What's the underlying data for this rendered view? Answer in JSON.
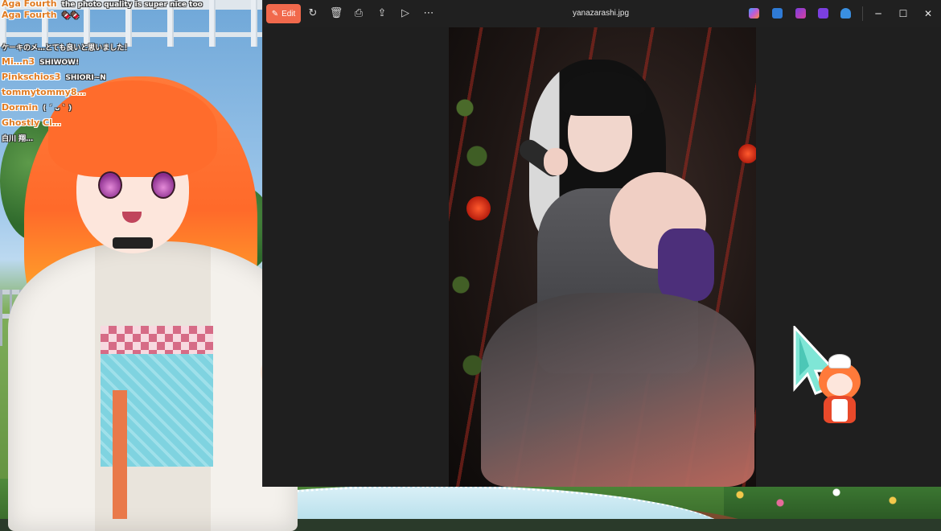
{
  "chat": {
    "lines": [
      {
        "user": "Aga Fourth",
        "message": "the photo quality is super nice too"
      },
      {
        "user": "",
        "message": "ケーキのメ…とても良いと思いました！"
      },
      {
        "user": "Mi…n3",
        "message": "SHIWOW!"
      },
      {
        "user": "Pinkschios3",
        "message": "SHIORI~N"
      },
      {
        "user": "tommytommy8…",
        "message": ""
      },
      {
        "user": "Dormin",
        "message": "( ´ ᴗ ` )"
      },
      {
        "user": "Ghostly Cl…",
        "message": ""
      },
      {
        "user": "白川 翔…",
        "message": ""
      }
    ]
  },
  "window": {
    "edit_label": "Edit",
    "filename": "yanazarashi.jpg",
    "toolbar_icons": [
      "rotate-icon",
      "delete-icon",
      "print-icon",
      "share-icon",
      "slideshow-icon",
      "more-icon"
    ],
    "app_icons": [
      {
        "name": "copilot-icon",
        "color": "#c05ad6"
      },
      {
        "name": "clipchamp-icon",
        "color": "#2f7bd6"
      },
      {
        "name": "designer-icon",
        "color": "#d63fa0"
      },
      {
        "name": "clipchamp-video-icon",
        "color": "#7b3fe0"
      },
      {
        "name": "onedrive-icon",
        "color": "#3a8fe0"
      }
    ],
    "controls": {
      "minimize": "─",
      "maximize": "☐",
      "close": "✕"
    }
  },
  "colors": {
    "edit_accent": "#f1694c",
    "titlebar": "#202020",
    "viewer_bg": "#1f1f1f",
    "chat_username": "#e07b22"
  }
}
